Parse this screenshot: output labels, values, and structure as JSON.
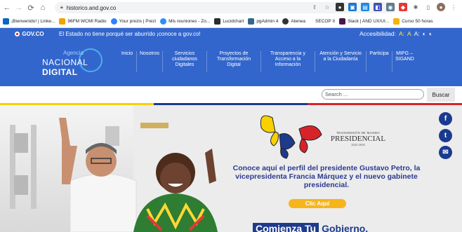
{
  "browser": {
    "url": "historico.and.gov.co",
    "bookmarks": [
      {
        "label": "¡Bienvenido! | Linke...",
        "color": "#0a66c2"
      },
      {
        "label": "96FM WCMI Radio",
        "color": "#f2a300"
      },
      {
        "label": "Your prezis | Prezi",
        "color": "#3181ff"
      },
      {
        "label": "Mis reuniones - Zo...",
        "color": "#2d8cff"
      },
      {
        "label": "Lucidchart",
        "color": "#282c33"
      },
      {
        "label": "pgAdmin 4",
        "color": "#336791"
      },
      {
        "label": "Atenea",
        "color": "#333333"
      },
      {
        "label": "SECOP II",
        "color": "#9e9e9e"
      },
      {
        "label": "Slack | AND UX/UI...",
        "color": "#4a154b"
      },
      {
        "label": "Curso 50 horas",
        "color": "#f4b400"
      }
    ]
  },
  "govbar": {
    "logo": "GOV.CO",
    "message": "El Estado no tiene porqué ser aburrido ¡conoce a gov.co!",
    "accessibility_label": "Accesibilidad:",
    "accessibility_controls": [
      "A:",
      "A",
      "A:",
      "◐",
      "◐"
    ]
  },
  "agency": {
    "logo_small": "Agencia",
    "logo_prefix": "NACIONAL",
    "logo_bold": "DIGITAL",
    "nav": [
      {
        "label": "Inicio"
      },
      {
        "label": "Nosotros"
      },
      {
        "label": "Servicios ciudadanos Digitales"
      },
      {
        "label": "Proyectos de Transformación Digital"
      },
      {
        "label": "Transparencia y Acceso a la Información"
      },
      {
        "label": "Atención y Servicio a la Ciudadanía"
      },
      {
        "label": "Participa"
      },
      {
        "label": "MIPG – SIGAND"
      }
    ]
  },
  "search": {
    "placeholder": "Search ...",
    "button": "Buscar"
  },
  "hero": {
    "transmision_line1": "TRANSMISIÓN DE MANDO",
    "transmision_line2": "PRESIDENCIAL",
    "transmision_line3": "2022-2026",
    "headline": "Conoce aquí el perfil del presidente Gustavo Petro, la vicepresidenta Francia Márquez y el nuevo gabinete presidencial.",
    "cta": "Clic Aquí",
    "banner_a": "Comienza Tu",
    "banner_b": "Gobierno."
  },
  "colors": {
    "gov_blue": "#3366cc",
    "cta_yellow": "#f6b51b",
    "headline_blue": "#2b3a8f",
    "social_bg": "#1a3a8f"
  }
}
